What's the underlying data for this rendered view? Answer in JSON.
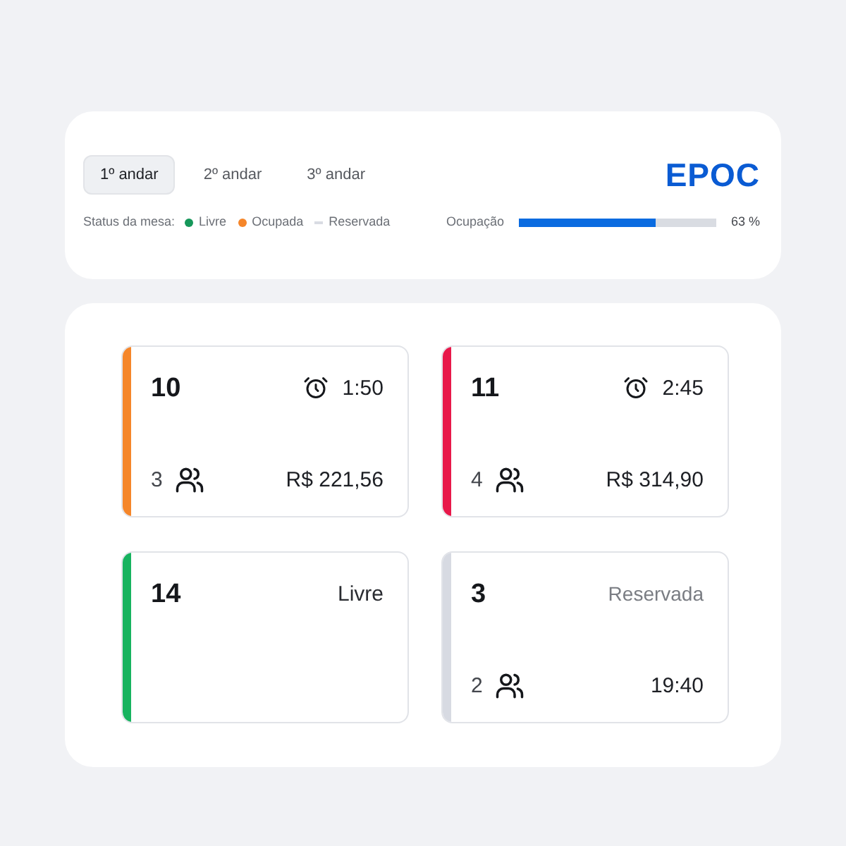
{
  "floor_tabs": [
    {
      "label": "1º andar",
      "selected": true
    },
    {
      "label": "2º andar",
      "selected": false
    },
    {
      "label": "3º andar",
      "selected": false
    }
  ],
  "logo": {
    "text": "EPOC"
  },
  "status_legend": {
    "label": "Status da mesa:",
    "items": [
      {
        "label": "Livre",
        "color": "#16975a",
        "kind": "dot"
      },
      {
        "label": "Ocupada",
        "color": "#f5862a",
        "kind": "dot"
      },
      {
        "label": "Reservada",
        "color": "#d9dce3",
        "kind": "dash"
      }
    ]
  },
  "occupancy": {
    "label": "Ocupação",
    "level": 0.69,
    "reading": "63 %"
  },
  "tables": [
    {
      "number": "10",
      "color": "#f5862a",
      "kind": "occupied",
      "timer": "1:50",
      "guests": "3",
      "amount": "R$ 221,56"
    },
    {
      "number": "11",
      "color": "#e8184a",
      "kind": "occupied",
      "timer": "2:45",
      "guests": "4",
      "amount": "R$ 314,90"
    },
    {
      "number": "14",
      "color": "#17b35f",
      "kind": "free",
      "status": "Livre"
    },
    {
      "number": "3",
      "color": "#d7dae2",
      "kind": "reserved",
      "status": "Reservada",
      "guests": "2",
      "time": "19:40"
    }
  ]
}
